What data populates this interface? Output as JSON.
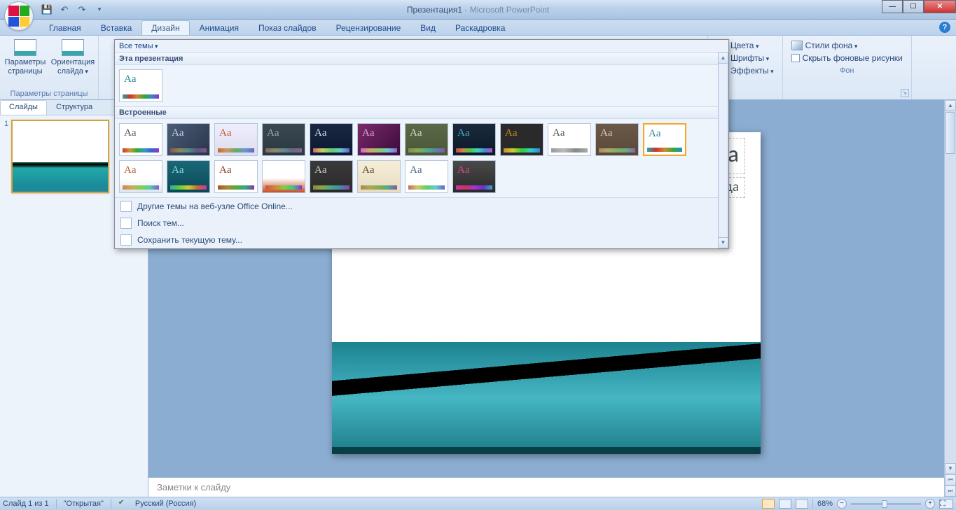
{
  "app": {
    "doc_name": "Презентация1",
    "app_name": "Microsoft PowerPoint"
  },
  "qat": {
    "save": "save-icon",
    "undo": "undo-icon",
    "redo": "redo-icon"
  },
  "tabs": {
    "items": [
      "Главная",
      "Вставка",
      "Дизайн",
      "Анимация",
      "Показ слайдов",
      "Рецензирование",
      "Вид",
      "Раскадровка"
    ],
    "active_index": 2
  },
  "ribbon": {
    "page_setup": {
      "btn1": "Параметры страницы",
      "btn2": "Ориентация слайда",
      "label": "Параметры страницы"
    },
    "themes_header": "Все темы",
    "section_this": "Эта презентация",
    "section_builtin": "Встроенные",
    "foot_online": "Другие темы на веб-узле Office Online...",
    "foot_browse": "Поиск тем...",
    "foot_save": "Сохранить текущую тему...",
    "side": {
      "colors": "Цвета",
      "fonts": "Шрифты",
      "effects": "Эффекты"
    },
    "bg_group": {
      "styles": "Стили фона",
      "hide": "Скрыть фоновые рисунки",
      "label": "Фон"
    }
  },
  "builtin_themes": [
    {
      "bg": "#ffffff",
      "aa": "#555",
      "strip": "linear-gradient(to right,#c33,#c93,#3a3,#39c,#36c,#93c)"
    },
    {
      "bg": "linear-gradient(135deg,#4a5d78,#2a3548)",
      "aa": "#c8d0dc",
      "strip": "linear-gradient(to right,#855,#885,#588,#558,#858)"
    },
    {
      "bg": "linear-gradient(to bottom,#eef,#dde)",
      "aa": "#c85a2a",
      "strip": "linear-gradient(to right,#c63,#c96,#6a6,#69c,#66c)"
    },
    {
      "bg": "linear-gradient(to bottom,#3a4852,#2a3842)",
      "aa": "#9aa",
      "strip": "linear-gradient(to right,#866,#886,#688,#668,#868)"
    },
    {
      "bg": "linear-gradient(to bottom,#1a2842,#0a1832)",
      "aa": "#dde",
      "strip": "linear-gradient(to right,#c66,#cc6,#6c6,#6cc,#66c)"
    },
    {
      "bg": "linear-gradient(135deg,#7a2a6a,#3a0a3a)",
      "aa": "#d8a8d0",
      "strip": "linear-gradient(to right,#c6c,#ca6,#8c6,#6cc,#86c)"
    },
    {
      "bg": "linear-gradient(to bottom,#5a6848,#4a5838)",
      "aa": "#cdc",
      "strip": "linear-gradient(to right,#885,#8a5,#5a8,#58a,#85a)"
    },
    {
      "bg": "linear-gradient(to bottom,#1a2a3a,#0a1a2a)",
      "aa": "#4ac",
      "strip": "linear-gradient(to right,#c44,#c84,#4c4,#4cc,#48c,#c4c)"
    },
    {
      "bg": "#2a2a2a",
      "aa": "#cc8822",
      "strip": "linear-gradient(to right,#c83,#cc3,#3c3,#3cc,#38c)"
    },
    {
      "bg": "#ffffff",
      "aa": "#555",
      "strip": "linear-gradient(to right,#999,#bbb,#888,#aaa)"
    },
    {
      "bg": "linear-gradient(to bottom,#6a5848,#5a4838)",
      "aa": "#dcb",
      "strip": "linear-gradient(to right,#a86,#aa6,#8a6,#6a8,#86a)"
    },
    {
      "bg": "#ffffff",
      "aa": "#2a8a9a",
      "strip": "linear-gradient(to right,#2aa,#c33,#c83,#3a3,#38c)",
      "sel": true
    },
    {
      "bg": "linear-gradient(to bottom,#fff 60%,#d8e6f0)",
      "aa": "#b85a3a",
      "strip": "linear-gradient(to right,#c85,#ca5,#8c5,#5ca,#85c)"
    },
    {
      "bg": "linear-gradient(to bottom,#1a6878,#0a4858)",
      "aa": "#8dd",
      "strip": "linear-gradient(to right,#3aa,#6c3,#cc3,#c63,#c3a)"
    },
    {
      "bg": "#ffffff",
      "aa": "#8a3a2a",
      "strip": "linear-gradient(to right,#a53,#a83,#5a3,#3a8,#83a)"
    },
    {
      "bg": "linear-gradient(to bottom,#fff 55%,#c84a2a)",
      "aa": "#fff",
      "strip": "linear-gradient(to right,#c53,#c83,#8c3,#3c8,#83c)"
    },
    {
      "bg": "linear-gradient(to bottom,#3a3a3a,#2a2a2a)",
      "aa": "#ccc",
      "strip": "linear-gradient(to right,#884,#8a4,#4a8,#48a,#84a)"
    },
    {
      "bg": "linear-gradient(to bottom,#f5eed8,#e8dcc0)",
      "aa": "#5a4a2a",
      "strip": "linear-gradient(to right,#a85,#aa5,#8a5,#5a8,#85a)"
    },
    {
      "bg": "#ffffff",
      "aa": "#4a6a8a",
      "strip": "linear-gradient(to right,#c66,#cc6,#6c6,#6cc,#66c)"
    },
    {
      "bg": "linear-gradient(to bottom,#4a4a4a,#2a2a2a)",
      "aa": "#d84a8a",
      "strip": "linear-gradient(to right,#c3a,#c36,#a3c,#63c,#3ac)"
    }
  ],
  "side_panel": {
    "tab_slides": "Слайды",
    "tab_outline": "Структура",
    "slide_number": "1"
  },
  "slide": {
    "title": "Заголовок слайда",
    "subtitle": "Подзаголовок слайда"
  },
  "notes": {
    "placeholder": "Заметки к слайду"
  },
  "status": {
    "slide_counter": "Слайд 1 из 1",
    "theme_name": "\"Открытая\"",
    "lang": "Русский (Россия)",
    "zoom": "68%"
  }
}
